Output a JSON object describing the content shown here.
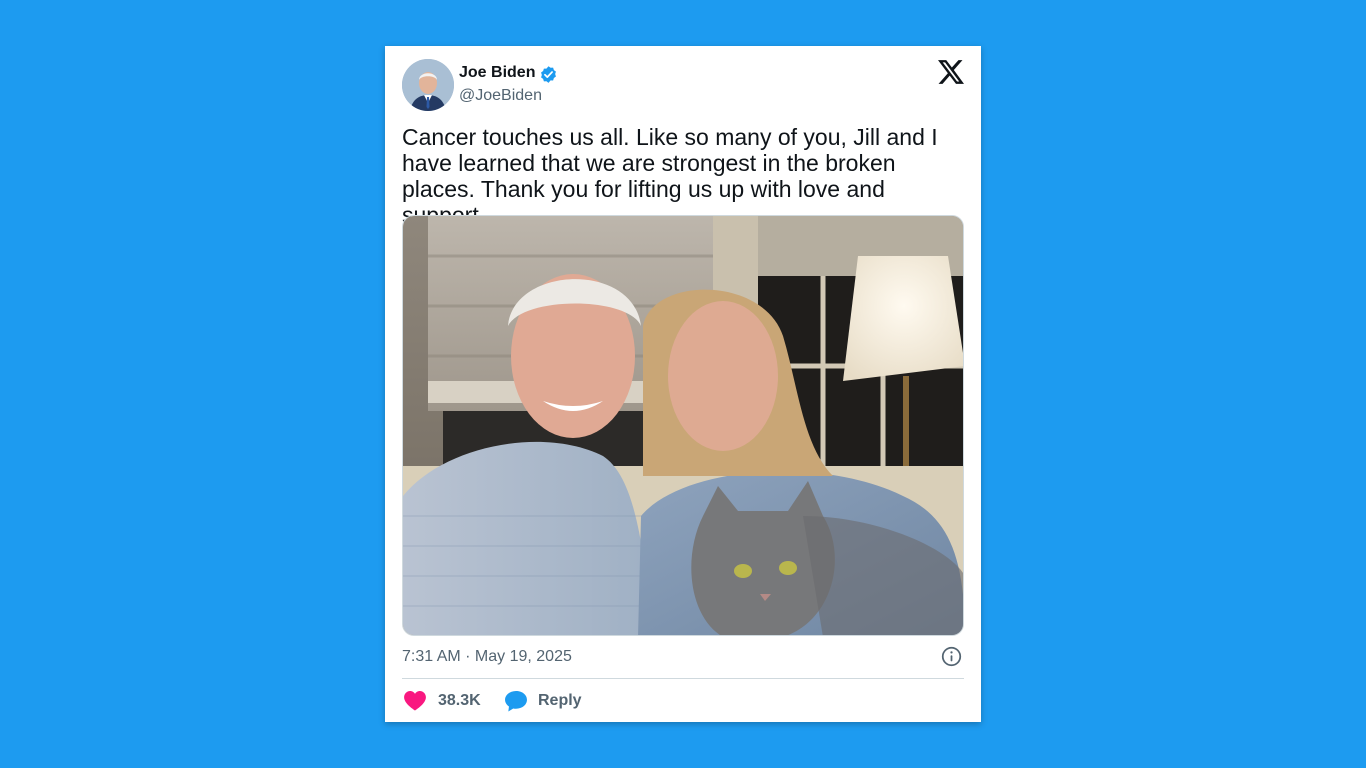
{
  "colors": {
    "background": "#1d9bf0",
    "card": "#ffffff",
    "verified": "#1d9bf0",
    "like": "#f91880",
    "reply": "#1d9bf0",
    "secondary_text": "#536471"
  },
  "tweet": {
    "author_name": "Joe Biden",
    "handle": "@JoeBiden",
    "verified_icon": "verified-badge-icon",
    "platform_icon": "x-logo-icon",
    "text": "Cancer touches us all. Like so many of you, Jill and I have learned that we are strongest in the broken places. Thank you for lifting us up with love and support.",
    "timestamp": "7:31 AM · May 19, 2025",
    "info_icon": "info-icon",
    "likes": "38.3K",
    "like_icon": "heart-icon",
    "reply_label": "Reply",
    "reply_icon": "speech-bubble-icon"
  }
}
